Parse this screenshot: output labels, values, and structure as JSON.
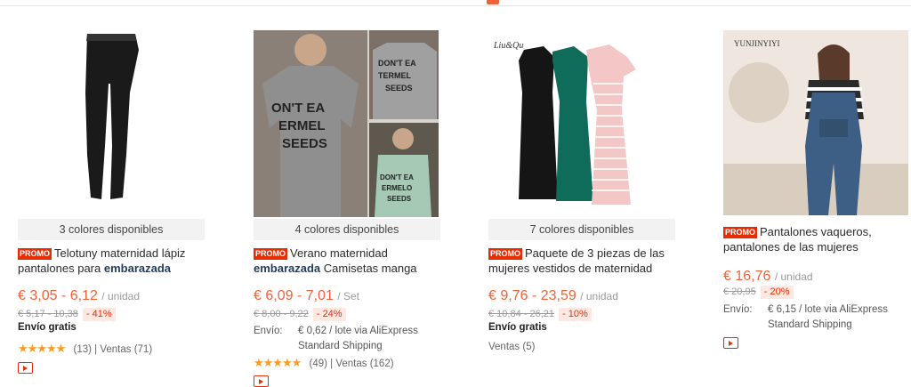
{
  "products": [
    {
      "colors_label": "3 colores disponibles",
      "promo": "PROMO",
      "title_pre": "Telotuny maternidad lápiz pantalones para ",
      "title_kw": "embarazada",
      "title_post": "",
      "price": "€ 3,05 - 6,12",
      "unit": "/ unidad",
      "old_price": "€ 5,17 - 10,38",
      "discount": "- 41%",
      "shipping_free": "Envío gratis",
      "rating": 4.5,
      "reviews": "(13)",
      "separator": "|",
      "orders": "Ventas (71)"
    },
    {
      "colors_label": "4 colores disponibles",
      "promo": "PROMO",
      "title_pre": "Verano maternidad ",
      "title_kw": "embarazada",
      "title_post": " Camisetas manga",
      "price": "€ 6,09 - 7,01",
      "unit": "/ Set",
      "old_price": "€ 8,00 - 9,22",
      "discount": "- 24%",
      "shipping_label": "Envío:",
      "shipping_value_1": "€ 0,62 / lote via AliExpress",
      "shipping_value_2": "Standard Shipping",
      "rating": 4.5,
      "reviews": "(49)",
      "separator": "|",
      "orders": "Ventas (162)"
    },
    {
      "colors_label": "7 colores disponibles",
      "promo": "PROMO",
      "title_pre": "Paquete de 3 piezas de las mujeres vestidos de maternidad",
      "price": "€ 9,76 - 23,59",
      "unit": "/ unidad",
      "old_price": "€ 10,84 - 26,21",
      "discount": "- 10%",
      "shipping_free": "Envío gratis",
      "orders": "Ventas (5)"
    },
    {
      "promo": "PROMO",
      "title_pre": "Pantalones vaqueros, pantalones de las mujeres",
      "price": "€ 16,76",
      "unit": "/ unidad",
      "old_price": "€ 20,95",
      "discount": "- 20%",
      "shipping_label": "Envío:",
      "shipping_value_1": "€ 6,15 / lote via AliExpress",
      "shipping_value_2": "Standard Shipping",
      "brand_watermark": "YUNJINYIYI"
    }
  ],
  "colors": {
    "accent": "#f0623a",
    "promo": "#e62e04",
    "keyword": "#1f3b5e",
    "star": "#ff9a1f"
  },
  "icons": {
    "rating": "star-icon",
    "video": "video-play-icon"
  }
}
